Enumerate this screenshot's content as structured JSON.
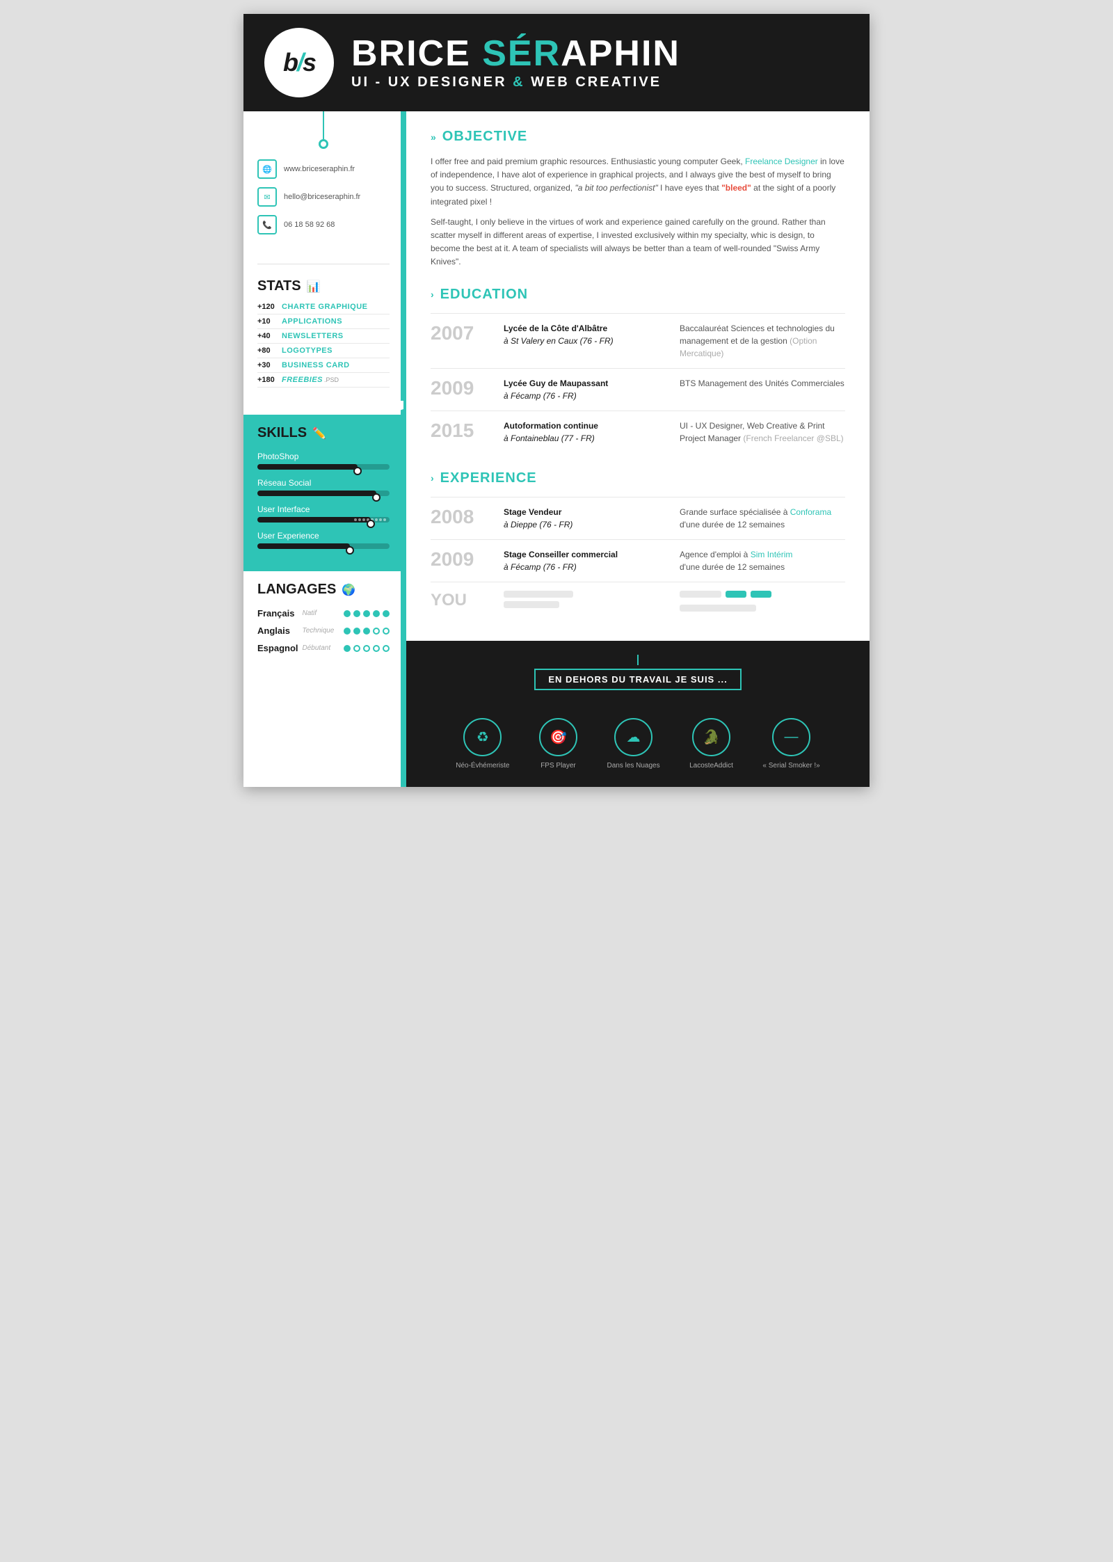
{
  "header": {
    "logo": "b/s",
    "name_part1": "BRICE ",
    "name_teal": "SÉR",
    "name_part2": "APHIN",
    "subtitle": "UI - UX DESIGNER ",
    "subtitle_amp": "&",
    "subtitle_end": " WEB CREATIVE"
  },
  "contact": {
    "website": "www.briceseraphin.fr",
    "email": "hello@briceseraphin.fr",
    "phone": "06 18 58 92 68"
  },
  "stats": {
    "title": "STATS",
    "items": [
      {
        "number": "+120",
        "label": "CHARTE GRAPHIQUE"
      },
      {
        "number": "+10",
        "label": "APPLICATIONS"
      },
      {
        "number": "+40",
        "label": "NEWSLETTERS"
      },
      {
        "number": "+80",
        "label": "LOGOTYPES"
      },
      {
        "number": "+30",
        "label": "BUSINESS CARD"
      },
      {
        "number": "+180",
        "label": "FREEBIES",
        "sub": ".PSD"
      }
    ]
  },
  "skills": {
    "title": "SKILLS",
    "items": [
      {
        "name": "PhotoShop",
        "pct": 76,
        "label": "76%"
      },
      {
        "name": "Réseau Social",
        "pct": 90,
        "label": "96%"
      },
      {
        "name": "User Interface",
        "pct": 86,
        "label": "86%"
      },
      {
        "name": "User Experience",
        "pct": 70,
        "label": "70%"
      }
    ]
  },
  "languages": {
    "title": "LANGAGES",
    "items": [
      {
        "name": "Français",
        "level": "Natif",
        "filled": 5,
        "total": 5
      },
      {
        "name": "Anglais",
        "level": "Technique",
        "filled": 3,
        "total": 5
      },
      {
        "name": "Espagnol",
        "level": "Débutant",
        "filled": 1,
        "total": 5
      }
    ]
  },
  "objective": {
    "section_label": "OBJECTIVE",
    "para1": "I offer free and paid premium graphic resources. Enthusiastic young computer Geek, ",
    "para1_teal": "Freelance Designer",
    "para1_cont": " in love of independence, I have alot of experience in graphical projects, and I always give the best of myself to bring you to success. Structured, organized, ",
    "para1_italic": "\"a bit too perfectionist\"",
    "para1_cont2": " I have eyes that ",
    "para1_red": "\"bleed\"",
    "para1_end": " at the sight of a poorly integrated pixel !",
    "para2": "Self-taught, I only believe in the virtues of work and experience gained carefully on the ground. Rather than scatter myself in different areas of expertise, I invested exclusively within my specialty, whic is design, to become the best at it. A team of specialists will always be better than a team of well-rounded  \"Swiss Army Knives\"."
  },
  "education": {
    "section_label": "EDUCATION",
    "items": [
      {
        "year": "2007",
        "school": "Lycée de la Côte d'Albâtre",
        "location": "à St Valery en Caux (76 - FR)",
        "desc": "Baccalauréat Sciences et technologies du management et de la gestion ",
        "desc_sub": "(Option Mercatique)"
      },
      {
        "year": "2009",
        "school": "Lycée Guy de Maupassant",
        "location": "à Fécamp (76 - FR)",
        "desc": "BTS Management des Unités Commerciales",
        "desc_sub": ""
      },
      {
        "year": "2015",
        "school": "Autoformation continue",
        "location": "à Fontaineblau (77 - FR)",
        "desc": "UI - UX Designer, Web Creative & Print Project Manager ",
        "desc_sub": "(French Freelancer @SBL)"
      }
    ]
  },
  "experience": {
    "section_label": "EXPERIENCE",
    "items": [
      {
        "year": "2008",
        "title": "Stage Vendeur",
        "location": "à Dieppe (76 - FR)",
        "desc": "Grande surface spécialisée à ",
        "desc_teal": "Conforama",
        "desc_end": "d'une durée de 12 semaines",
        "desc_sub": ""
      },
      {
        "year": "2009",
        "title": "Stage Conseiller commercial",
        "location": "à Fécamp (76 - FR)",
        "desc": "Agence d'emploi à ",
        "desc_teal": "Sim Intérim",
        "desc_end": "d'une durée de 12 semaines",
        "desc_sub": ""
      }
    ]
  },
  "footer": {
    "title": "EN DEHORS DU TRAVAIL JE SUIS ...",
    "icons": [
      {
        "label": "Néo-Évhémeriste",
        "icon": "♻"
      },
      {
        "label": "FPS Player",
        "icon": "🎯"
      },
      {
        "label": "Dans les Nuages",
        "icon": "☁"
      },
      {
        "label": "LacosteAddict",
        "icon": "🐊"
      },
      {
        "label": "« Serial Smoker !»",
        "icon": "—"
      }
    ]
  }
}
